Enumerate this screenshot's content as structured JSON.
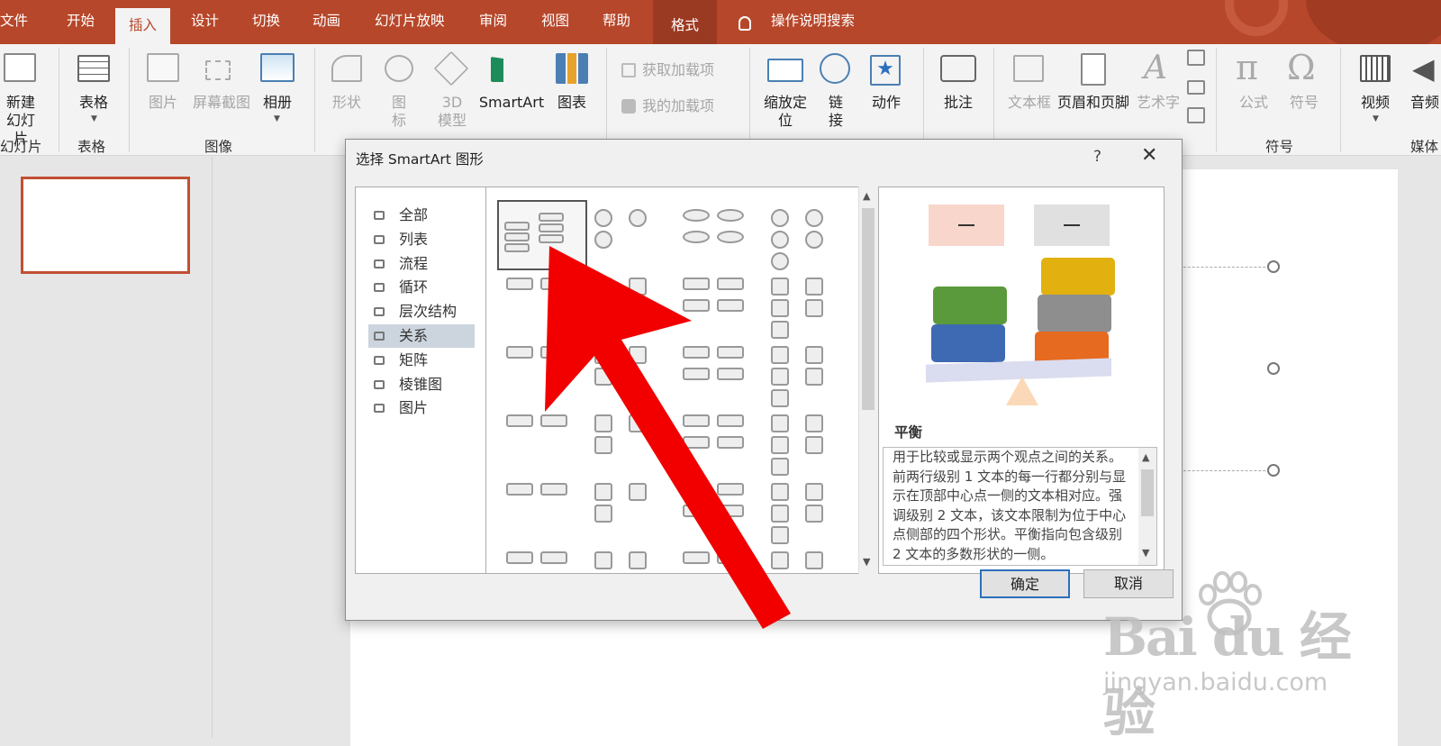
{
  "tabs": {
    "file": "文件",
    "home": "开始",
    "insert": "插入",
    "design": "设计",
    "transitions": "切换",
    "animations": "动画",
    "slideshow": "幻灯片放映",
    "review": "审阅",
    "view": "视图",
    "help": "帮助",
    "format": "格式",
    "tell_me": "操作说明搜索"
  },
  "ribbon": {
    "new_slide": "新建\n幻灯片",
    "group_slides": "幻灯片",
    "table": "表格",
    "group_table": "表格",
    "pictures": "图片",
    "screenshot": "屏幕截图",
    "album": "相册",
    "group_images": "图像",
    "shapes": "形状",
    "icons": "图\n标",
    "models3d": "3D\n模型",
    "smartart": "SmartArt",
    "chart": "图表",
    "get_addins": "获取加载项",
    "my_addins": "我的加载项",
    "zoom": "缩放定\n位",
    "link": "链\n接",
    "action": "动作",
    "comment": "批注",
    "textbox": "文本框",
    "header_footer": "页眉和页脚",
    "wordart": "艺术字",
    "equation": "公式",
    "symbol": "符号",
    "group_symbols": "符号",
    "video": "视频",
    "audio": "音频",
    "group_media": "媒体"
  },
  "dialog": {
    "title": "选择 SmartArt 图形",
    "help": "?",
    "close": "✕",
    "categories": [
      {
        "label": "全部",
        "icon": "all-icon"
      },
      {
        "label": "列表",
        "icon": "list-icon"
      },
      {
        "label": "流程",
        "icon": "process-icon"
      },
      {
        "label": "循环",
        "icon": "cycle-icon"
      },
      {
        "label": "层次结构",
        "icon": "hierarchy-icon"
      },
      {
        "label": "关系",
        "icon": "relationship-icon",
        "selected": true
      },
      {
        "label": "矩阵",
        "icon": "matrix-icon"
      },
      {
        "label": "棱锥图",
        "icon": "pyramid-icon"
      },
      {
        "label": "图片",
        "icon": "picture-icon"
      }
    ],
    "preview_title": "平衡",
    "preview_desc": "用于比较或显示两个观点之间的关系。前两行级别 1 文本的每一行都分别与显示在顶部中心点一侧的文本相对应。强调级别 2 文本，该文本限制为位于中心点侧部的四个形状。平衡指向包含级别 2 文本的多数形状的一侧。",
    "ok": "确定",
    "cancel": "取消"
  },
  "watermark": {
    "brand": "Bai du 经验",
    "url": "jingyan.baidu.com"
  },
  "colors": {
    "accent": "#b7472a",
    "arrow": "#f20000",
    "ok_border": "#2b6fbd"
  }
}
